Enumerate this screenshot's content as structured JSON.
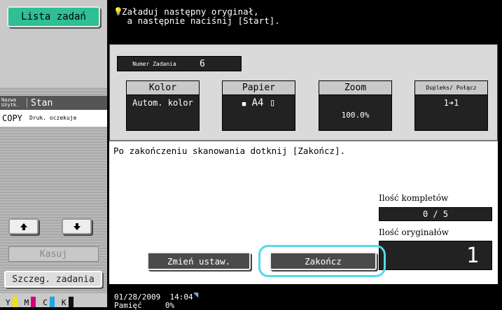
{
  "left_panel": {
    "job_list_button": "Lista zadań",
    "table": {
      "col1_header": "Nazwa Użytk.",
      "col2_header": "Stan",
      "row_user": "COPY",
      "row_status": "Druk. oczekuje"
    },
    "kasuj_button": "Kasuj",
    "details_button": "Szczeg. zadania",
    "toners": [
      {
        "letter": "Y",
        "color": "#f5e100"
      },
      {
        "letter": "M",
        "color": "#d4007a"
      },
      {
        "letter": "C",
        "color": "#1aa7e8"
      },
      {
        "letter": "K",
        "color": "#111111"
      }
    ]
  },
  "message": "Załaduj następny oryginał,\n a następnie naciśnij [Start].",
  "job": {
    "number_label": "Numer Zadania",
    "number_value": "6"
  },
  "cards": {
    "color": {
      "label": "Kolor",
      "value": "Autom. kolor"
    },
    "paper": {
      "label": "Papier",
      "value": "A4"
    },
    "zoom": {
      "label": "Zoom",
      "value": "100.0%"
    },
    "duplex": {
      "label": "Dupleks/ Połącz",
      "value": "1➔1"
    }
  },
  "info_text": "Po zakończeniu skanowania dotknij [Zakończ].",
  "sets": {
    "label": "Ilość kompletów",
    "value": "0 / 5"
  },
  "originals": {
    "label": "Ilość oryginałów",
    "value": "1"
  },
  "buttons": {
    "change_settings": "Zmień ustaw.",
    "finish": "Zakończ"
  },
  "status": {
    "date": "01/28/2009",
    "time": "14:04",
    "memory_label": "Pamięć",
    "memory_value": "0%"
  },
  "accent_color": "#2fbf95",
  "highlight_color": "#56d8ec"
}
